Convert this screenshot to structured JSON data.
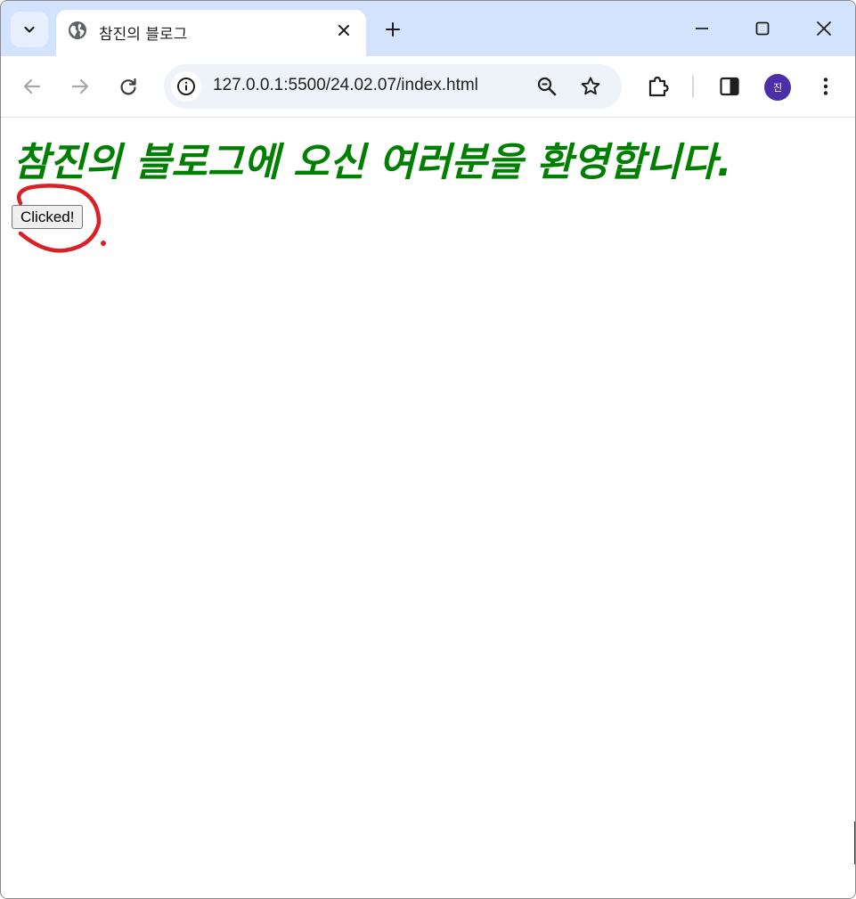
{
  "browser": {
    "tab": {
      "title": "참진의 블로그",
      "favicon": "globe-icon"
    },
    "toolbar": {
      "url": "127.0.0.1:5500/24.02.07/index.html"
    },
    "profile": {
      "initial": "진",
      "color": "#4a2fa8"
    },
    "tabstrip_color": "#d3e3fd"
  },
  "page": {
    "heading": "참진의 블로그에 오신 여러분을 환영합니다.",
    "heading_color": "#008000",
    "button_label": "Clicked!",
    "annotation_color": "#d92027"
  }
}
